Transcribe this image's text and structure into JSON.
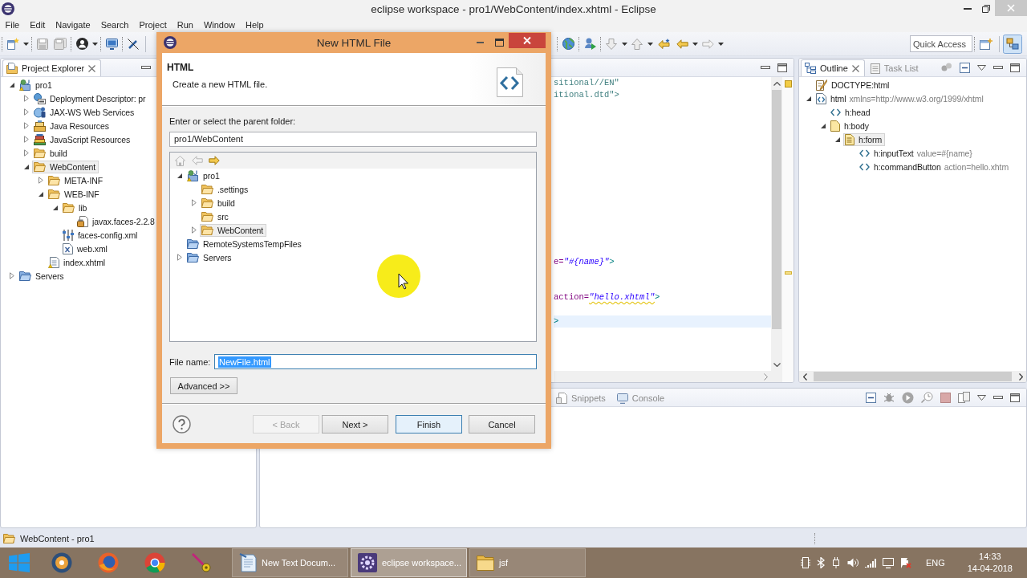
{
  "window": {
    "title": "eclipse workspace - pro1/WebContent/index.xhtml - Eclipse"
  },
  "menu": [
    "File",
    "Edit",
    "Navigate",
    "Search",
    "Project",
    "Run",
    "Window",
    "Help"
  ],
  "toolbar": {
    "quick_access": {
      "placeholder": "Quick Access"
    },
    "perspectives": [
      {
        "selected": true
      }
    ]
  },
  "project_explorer": {
    "tab": {
      "label": "Project Explorer",
      "selected": true
    },
    "tree": [
      {
        "label": "pro1",
        "kind": "project",
        "expanded": true,
        "selected": false,
        "children": [
          {
            "label": "Deployment Descriptor: pr",
            "kind": "descriptor",
            "expanded": false,
            "selected": false
          },
          {
            "label": "JAX-WS Web Services",
            "kind": "webservices",
            "expanded": false,
            "selected": false
          },
          {
            "label": "Java Resources",
            "kind": "javares",
            "expanded": false,
            "selected": false
          },
          {
            "label": "JavaScript Resources",
            "kind": "jsres",
            "expanded": false,
            "selected": false
          },
          {
            "label": "build",
            "kind": "folder",
            "expanded": false,
            "selected": false
          },
          {
            "label": "WebContent",
            "kind": "folder",
            "expanded": true,
            "selected": true,
            "children": [
              {
                "label": "META-INF",
                "kind": "folder",
                "expanded": false,
                "selected": false
              },
              {
                "label": "WEB-INF",
                "kind": "folder",
                "expanded": true,
                "selected": false,
                "children": [
                  {
                    "label": "lib",
                    "kind": "folder",
                    "expanded": true,
                    "selected": false,
                    "children": [
                      {
                        "label": "javax.faces-2.2.8",
                        "kind": "jar",
                        "selected": false
                      }
                    ]
                  },
                  {
                    "label": "faces-config.xml",
                    "kind": "facesconfig",
                    "selected": false
                  },
                  {
                    "label": "web.xml",
                    "kind": "xml",
                    "selected": false
                  }
                ]
              },
              {
                "label": "index.xhtml",
                "kind": "page",
                "selected": false
              }
            ]
          }
        ]
      },
      {
        "label": "Servers",
        "kind": "serverfolder",
        "expanded": false,
        "selected": false
      }
    ]
  },
  "editor": {
    "lines": [
      {
        "current": false,
        "segments": [
          {
            "text": "sitional//EN\"",
            "kind": "doctype",
            "warning": false
          }
        ]
      },
      {
        "current": false,
        "segments": [
          {
            "text": "itional.dtd\">",
            "kind": "doctype",
            "warning": false
          }
        ]
      },
      {
        "current": false,
        "segments": [
          {
            "text": "e=",
            "kind": "attribute",
            "warning": false
          },
          {
            "text": "\"#{name}\"",
            "kind": "value",
            "warning": false
          },
          {
            "text": ">",
            "kind": "bracket",
            "warning": false
          }
        ]
      },
      {
        "current": false,
        "segments": [
          {
            "text": "action=",
            "kind": "attribute",
            "warning": false
          },
          {
            "text": "\"hello.xhtml\"",
            "kind": "value",
            "warning": true
          },
          {
            "text": ">",
            "kind": "bracket",
            "warning": false
          }
        ]
      },
      {
        "current": true,
        "segments": [
          {
            "text": ">",
            "kind": "bracket",
            "warning": false
          }
        ]
      }
    ]
  },
  "outline": {
    "tabs": [
      {
        "label": "Outline",
        "kind": "outline",
        "selected": true
      },
      {
        "label": "Task List",
        "kind": "tasks",
        "selected": false
      }
    ],
    "tree": [
      {
        "label": "DOCTYPE:html",
        "kind": "doctype",
        "selected": false
      },
      {
        "label": "html",
        "attributes": "xmlns=http://www.w3.org/1999/xhtml",
        "kind": "element",
        "expanded": true,
        "selected": false,
        "children": [
          {
            "label": "h:head",
            "kind": "tag",
            "selected": false
          },
          {
            "label": "h:body",
            "kind": "body",
            "expanded": true,
            "selected": false,
            "children": [
              {
                "label": "h:form",
                "kind": "form",
                "expanded": true,
                "selected": true,
                "children": [
                  {
                    "label": "h:inputText",
                    "attributes": "value=#{name}",
                    "kind": "tag",
                    "selected": false
                  },
                  {
                    "label": "h:commandButton",
                    "attributes": "action=hello.xhtm",
                    "kind": "tag",
                    "selected": false
                  }
                ]
              }
            ]
          }
        ]
      }
    ]
  },
  "bottom_panel": {
    "tabs": [
      {
        "label": "Snippets",
        "kind": "snippets",
        "selected": false
      },
      {
        "label": "Console",
        "kind": "console",
        "selected": false
      }
    ]
  },
  "status_bar": {
    "text": "WebContent - pro1"
  },
  "dialog": {
    "title": "New HTML File",
    "heading": "HTML",
    "description": "Create a new HTML file.",
    "folder_label": "Enter or select the parent folder:",
    "folder_field": {
      "value": "pro1/WebContent"
    },
    "tree_nav": [
      {
        "kind": "home",
        "disabled": true
      },
      {
        "kind": "back",
        "disabled": true
      },
      {
        "kind": "forward",
        "disabled": false
      }
    ],
    "folder_tree": [
      {
        "label": "pro1",
        "kind": "project",
        "expanded": true,
        "selected": false,
        "children": [
          {
            "label": ".settings",
            "kind": "folder",
            "selected": false
          },
          {
            "label": "build",
            "kind": "folder",
            "expanded": false,
            "selected": false
          },
          {
            "label": "src",
            "kind": "folder",
            "selected": false
          },
          {
            "label": "WebContent",
            "kind": "folder",
            "expanded": false,
            "selected": true
          }
        ]
      },
      {
        "label": "RemoteSystemsTempFiles",
        "kind": "serverfolder",
        "selected": false
      },
      {
        "label": "Servers",
        "kind": "serverfolder",
        "expanded": false,
        "selected": false
      }
    ],
    "file_name": {
      "label": "File name:",
      "value": "NewFile.html",
      "text_selected": true
    },
    "advanced_button": "Advanced >>",
    "buttons": [
      {
        "label": "< Back",
        "disabled": true,
        "default": false
      },
      {
        "label": "Next >",
        "disabled": false,
        "default": false
      },
      {
        "label": "Finish",
        "disabled": false,
        "default": true
      },
      {
        "label": "Cancel",
        "disabled": false,
        "default": false
      }
    ]
  },
  "taskbar": {
    "windows": [
      {
        "label": "New Text Docum...",
        "kind": "notepad",
        "selected": false
      },
      {
        "label": "eclipse workspace...",
        "kind": "ide",
        "selected": true
      },
      {
        "label": "jsf",
        "kind": "folder",
        "selected": false
      }
    ],
    "tray": {
      "language": "ENG",
      "time": "14:33",
      "date": "14-04-2018"
    }
  }
}
